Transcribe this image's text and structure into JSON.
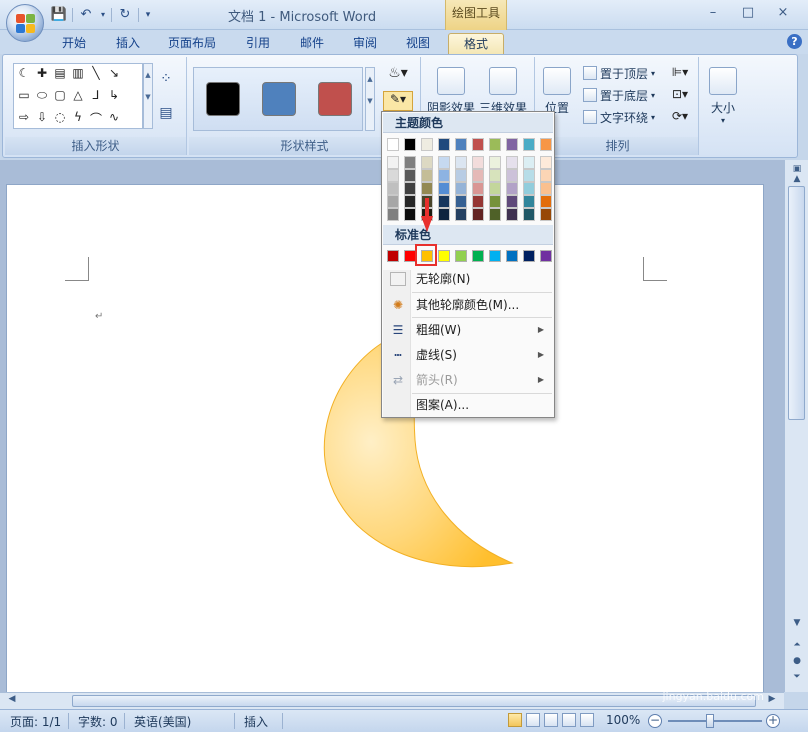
{
  "window": {
    "title": "文档 1 - Microsoft Word",
    "context_tool": "绘图工具",
    "controls": [
      "–",
      "□",
      "×"
    ]
  },
  "qat": {
    "items": [
      "save-icon",
      "undo-icon",
      "redo-icon"
    ]
  },
  "tabs": [
    {
      "label": "开始",
      "active": false
    },
    {
      "label": "插入",
      "active": false
    },
    {
      "label": "页面布局",
      "active": false
    },
    {
      "label": "引用",
      "active": false
    },
    {
      "label": "邮件",
      "active": false
    },
    {
      "label": "审阅",
      "active": false
    },
    {
      "label": "视图",
      "active": false
    },
    {
      "label": "格式",
      "active": true
    }
  ],
  "help": "?",
  "ribbon": {
    "groups": {
      "insert_shapes": "插入形状",
      "shape_styles": "形状样式",
      "arrange": "排列"
    },
    "style_swatches": [
      "#000000",
      "#4f81bd",
      "#c0504d"
    ],
    "shadow_effect": "阴影效果",
    "threed_effect": "三维效果",
    "position": "位置",
    "bring_front": "置于顶层",
    "send_back": "置于底层",
    "text_wrap": "文字环绕",
    "size": "大小"
  },
  "dropdown": {
    "theme_header": "主题颜色",
    "standard_header": "标准色",
    "theme_colors": [
      [
        "#ffffff",
        "#f2f2f2",
        "#d9d9d9",
        "#bfbfbf",
        "#a6a6a6",
        "#7f7f7f"
      ],
      [
        "#000000",
        "#7f7f7f",
        "#595959",
        "#404040",
        "#262626",
        "#0d0d0d"
      ],
      [
        "#eeece1",
        "#ddd9c3",
        "#c4bd97",
        "#938953",
        "#494429",
        "#1d1b10"
      ],
      [
        "#1f497d",
        "#c6d9f0",
        "#8db3e2",
        "#548dd4",
        "#17365d",
        "#0f243e"
      ],
      [
        "#4f81bd",
        "#dbe5f1",
        "#b8cce4",
        "#95b3d7",
        "#366092",
        "#244061"
      ],
      [
        "#c0504d",
        "#f2dcdb",
        "#e5b9b7",
        "#d99694",
        "#953734",
        "#632423"
      ],
      [
        "#9bbb59",
        "#ebf1dd",
        "#d7e3bc",
        "#c3d69b",
        "#76923c",
        "#4f6128"
      ],
      [
        "#8064a2",
        "#e5e0ec",
        "#ccc1d9",
        "#b2a2c7",
        "#5f497a",
        "#3f3151"
      ],
      [
        "#4bacc6",
        "#dbeef3",
        "#b7dde8",
        "#92cddc",
        "#31859b",
        "#205867"
      ],
      [
        "#f79646",
        "#fdeada",
        "#fbd5b5",
        "#fac08f",
        "#e36c09",
        "#974806"
      ]
    ],
    "standard_colors": [
      "#c00000",
      "#ff0000",
      "#ffc000",
      "#ffff00",
      "#92d050",
      "#00b050",
      "#00b0f0",
      "#0070c0",
      "#002060",
      "#7030a0"
    ],
    "items": [
      {
        "label": "无轮廓(N)",
        "icon": "no-outline-icon",
        "submenu": false,
        "disabled": false
      },
      {
        "label": "其他轮廓颜色(M)...",
        "icon": "palette-icon",
        "submenu": false,
        "disabled": false
      },
      {
        "label": "粗细(W)",
        "icon": "line-weight-icon",
        "submenu": true,
        "disabled": false
      },
      {
        "label": "虚线(S)",
        "icon": "dashes-icon",
        "submenu": true,
        "disabled": false
      },
      {
        "label": "箭头(R)",
        "icon": "arrows-icon",
        "submenu": true,
        "disabled": true
      },
      {
        "label": "图案(A)...",
        "icon": "",
        "submenu": false,
        "disabled": false
      }
    ]
  },
  "status": {
    "page": "页面: 1/1",
    "words": "字数: 0",
    "language": "英语(美国)",
    "insert_mode": "插入",
    "zoom": "100%"
  },
  "watermark": {
    "brand": "Baidu经验",
    "url": "jingyan.baidu.com"
  },
  "colors": {
    "shape_fill_light": "#ffe7b0",
    "shape_fill_dark": "#ffc53c",
    "highlight": "#e8302d"
  }
}
